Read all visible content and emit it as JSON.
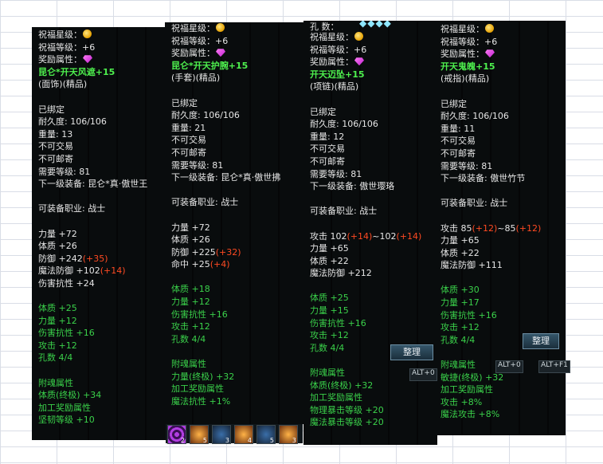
{
  "panels": [
    {
      "lines": [
        {
          "t": "祝福星级：",
          "c": "white",
          "icon": "sun"
        },
        {
          "t": "祝福等级：+6",
          "c": "white"
        },
        {
          "t": "奖励属性：",
          "c": "white",
          "icon": "gem"
        },
        {
          "t": "昆仑*开天风遮+15",
          "c": "bname"
        },
        {
          "t": "(面饰)(精品)",
          "c": "white"
        },
        {
          "t": "",
          "c": "white"
        },
        {
          "t": "已绑定",
          "c": "white"
        },
        {
          "t": "耐久度: 106/106",
          "c": "white"
        },
        {
          "t": "重量: 13",
          "c": "white"
        },
        {
          "t": "不可交易",
          "c": "white"
        },
        {
          "t": "不可邮寄",
          "c": "white"
        },
        {
          "t": "需要等级: 81",
          "c": "white"
        },
        {
          "t": "下一级装备: 昆仑*真·傲世王",
          "c": "white"
        },
        {
          "t": "",
          "c": "white"
        },
        {
          "t": "可装备职业: 战士",
          "c": "white"
        },
        {
          "t": "",
          "c": "white"
        },
        {
          "t": "力量 +72",
          "c": "white"
        },
        {
          "t": "体质 +26",
          "c": "white"
        },
        {
          "t": "防御 +242",
          "c": "white",
          "extra": "(+35)"
        },
        {
          "t": "魔法防御 +102",
          "c": "white",
          "extra": "(+14)"
        },
        {
          "t": "伤害抗性 +24",
          "c": "white"
        },
        {
          "t": "",
          "c": "white"
        },
        {
          "t": "体质       +25",
          "c": "green"
        },
        {
          "t": "力量       +12",
          "c": "green"
        },
        {
          "t": "伤害抗性 +16",
          "c": "green"
        },
        {
          "t": "攻击       +12",
          "c": "green"
        },
        {
          "t": "孔数 4/4",
          "c": "green"
        },
        {
          "t": "",
          "c": "white"
        },
        {
          "t": "附魂属性",
          "c": "green"
        },
        {
          "t": "  体质(终极) +34",
          "c": "green"
        },
        {
          "t": "加工奖励属性",
          "c": "green"
        },
        {
          "t": "坚韧等级 +10",
          "c": "green"
        }
      ]
    },
    {
      "lines": [
        {
          "t": "祝福星级：",
          "c": "white",
          "icon": "sun"
        },
        {
          "t": "祝福等级：+6",
          "c": "white"
        },
        {
          "t": "奖励属性：",
          "c": "white",
          "icon": "gem"
        },
        {
          "t": "昆仑*开天护腕+15",
          "c": "bname"
        },
        {
          "t": "(手套)(精品)",
          "c": "white"
        },
        {
          "t": "",
          "c": "white"
        },
        {
          "t": "已绑定",
          "c": "white"
        },
        {
          "t": "耐久度: 106/106",
          "c": "white"
        },
        {
          "t": "重量: 21",
          "c": "white"
        },
        {
          "t": "不可交易",
          "c": "white"
        },
        {
          "t": "不可邮寄",
          "c": "white"
        },
        {
          "t": "需要等级: 81",
          "c": "white"
        },
        {
          "t": "下一级装备: 昆仑*真·傲世拂",
          "c": "white"
        },
        {
          "t": "",
          "c": "white"
        },
        {
          "t": "可装备职业: 战士",
          "c": "white"
        },
        {
          "t": "",
          "c": "white"
        },
        {
          "t": "力量 +72",
          "c": "white"
        },
        {
          "t": "体质 +26",
          "c": "white"
        },
        {
          "t": "防御 +225",
          "c": "white",
          "extra": "(+32)"
        },
        {
          "t": "命中 +25",
          "c": "white",
          "extra": "(+4)"
        },
        {
          "t": "",
          "c": "white"
        },
        {
          "t": "体质       +18",
          "c": "green"
        },
        {
          "t": "力量       +12",
          "c": "green"
        },
        {
          "t": "伤害抗性 +16",
          "c": "green"
        },
        {
          "t": "攻击       +12",
          "c": "green"
        },
        {
          "t": "孔数 4/4",
          "c": "green"
        },
        {
          "t": "",
          "c": "white"
        },
        {
          "t": "附魂属性",
          "c": "green"
        },
        {
          "t": "  力量(终极) +32",
          "c": "green"
        },
        {
          "t": "加工奖励属性",
          "c": "green"
        },
        {
          "t": "魔法抗性 +1%",
          "c": "green"
        }
      ]
    },
    {
      "lines": [
        {
          "t": "祝福星级：",
          "c": "white",
          "icon": "sun"
        },
        {
          "t": "祝福等级：+6",
          "c": "white"
        },
        {
          "t": "奖励属性：",
          "c": "white",
          "icon": "gem"
        },
        {
          "t": "开天迈坠+15",
          "c": "bname"
        },
        {
          "t": "(项链)(精品)",
          "c": "white"
        },
        {
          "t": "",
          "c": "white"
        },
        {
          "t": "已绑定",
          "c": "white"
        },
        {
          "t": "耐久度: 106/106",
          "c": "white"
        },
        {
          "t": "重量: 12",
          "c": "white"
        },
        {
          "t": "不可交易",
          "c": "white"
        },
        {
          "t": "不可邮寄",
          "c": "white"
        },
        {
          "t": "需要等级: 81",
          "c": "white"
        },
        {
          "t": "下一级装备: 傲世璎珞",
          "c": "white"
        },
        {
          "t": "",
          "c": "white"
        },
        {
          "t": "可装备职业: 战士",
          "c": "white"
        },
        {
          "t": "",
          "c": "white"
        },
        {
          "t": "攻击 102",
          "c": "white",
          "extra": "(+14)",
          "tail": "~102",
          "extra2": "(+14)"
        },
        {
          "t": "力量 +65",
          "c": "white"
        },
        {
          "t": "体质 +22",
          "c": "white"
        },
        {
          "t": "魔法防御 +212",
          "c": "white"
        },
        {
          "t": "",
          "c": "white"
        },
        {
          "t": "体质       +25",
          "c": "green"
        },
        {
          "t": "力量       +15",
          "c": "green"
        },
        {
          "t": "伤害抗性 +16",
          "c": "green"
        },
        {
          "t": "攻击       +12",
          "c": "green"
        },
        {
          "t": "孔数 4/4",
          "c": "green"
        },
        {
          "t": "",
          "c": "white"
        },
        {
          "t": "附魂属性",
          "c": "green"
        },
        {
          "t": "  体质(终极) +32",
          "c": "green"
        },
        {
          "t": "加工奖励属性",
          "c": "green"
        },
        {
          "t": "物理暴击等级 +20",
          "c": "green"
        },
        {
          "t": "魔法暴击等级 +20",
          "c": "green"
        }
      ]
    },
    {
      "lines": [
        {
          "t": "祝福星级：",
          "c": "white",
          "icon": "sun"
        },
        {
          "t": "祝福等级：+6",
          "c": "white"
        },
        {
          "t": "奖励属性：",
          "c": "white",
          "icon": "gem"
        },
        {
          "t": "开天鬼魄+15",
          "c": "bname"
        },
        {
          "t": "(戒指)(精品)",
          "c": "white"
        },
        {
          "t": "",
          "c": "white"
        },
        {
          "t": "已绑定",
          "c": "white"
        },
        {
          "t": "耐久度: 106/106",
          "c": "white"
        },
        {
          "t": "重量: 11",
          "c": "white"
        },
        {
          "t": "不可交易",
          "c": "white"
        },
        {
          "t": "不可邮寄",
          "c": "white"
        },
        {
          "t": "需要等级: 81",
          "c": "white"
        },
        {
          "t": "下一级装备: 傲世竹节",
          "c": "white"
        },
        {
          "t": "",
          "c": "white"
        },
        {
          "t": "可装备职业: 战士",
          "c": "white"
        },
        {
          "t": "",
          "c": "white"
        },
        {
          "t": "攻击 85",
          "c": "white",
          "extra": "(+12)",
          "tail": "~85",
          "extra2": "(+12)"
        },
        {
          "t": "力量 +65",
          "c": "white"
        },
        {
          "t": "体质 +22",
          "c": "white"
        },
        {
          "t": "魔法防御 +111",
          "c": "white"
        },
        {
          "t": "",
          "c": "white"
        },
        {
          "t": "体质       +30",
          "c": "green"
        },
        {
          "t": "力量       +17",
          "c": "green"
        },
        {
          "t": "伤害抗性 +16",
          "c": "green"
        },
        {
          "t": "攻击       +12",
          "c": "green"
        },
        {
          "t": "孔数 4/4",
          "c": "green"
        },
        {
          "t": "",
          "c": "white"
        },
        {
          "t": "附魂属性",
          "c": "green"
        },
        {
          "t": "  敏捷(终极) +32",
          "c": "green"
        },
        {
          "t": "加工奖励属性",
          "c": "green"
        },
        {
          "t": "攻击       +8%",
          "c": "green"
        },
        {
          "t": "魔法攻击 +8%",
          "c": "green"
        }
      ]
    }
  ],
  "panel3_header": {
    "label": "孔   数：",
    "diamonds": "◆◆◆◆"
  },
  "buttons": {
    "sort": "整理",
    "sort2": "整理"
  },
  "hotkeys": [
    "ALT+0",
    "ALT+0",
    "ALT+F1"
  ],
  "slot_numbers": [
    "2",
    "5",
    "3",
    "4",
    "5",
    "3",
    "F8",
    "F9",
    "F7",
    "F8",
    "F9",
    "F10"
  ],
  "colors": {
    "green": "#3ad14a",
    "name_green": "#4ef04e",
    "red": "#ff4a22",
    "white": "#e6e6e6"
  }
}
